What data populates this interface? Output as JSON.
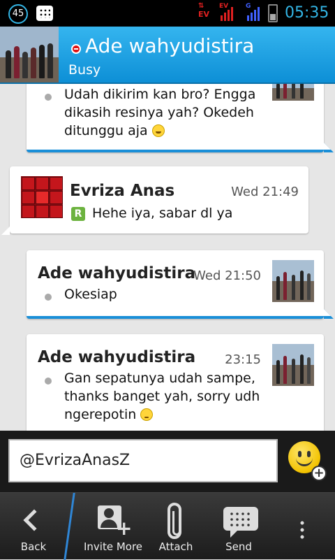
{
  "status_bar": {
    "notification_count": "45",
    "network_1": "EV",
    "network_2": "EV",
    "network_3": "G",
    "time": "05:35"
  },
  "header": {
    "contact_name": "Ade wahyudistira",
    "status": "Busy",
    "status_color": "#e01010",
    "accent": "#1a9ee0"
  },
  "messages": [
    {
      "sender": "",
      "time": "",
      "text_lines": [
        "Udah dikirim kan bro? Engga",
        "dikasih resinya yah? Okedeh",
        "ditunggu aja"
      ],
      "emoji": "grin-emoji",
      "outgoing": true
    },
    {
      "sender": "Evriza Anas",
      "time": "Wed 21:49",
      "text_lines": [
        "Hehe iya, sabar dl ya"
      ],
      "indicator": "R",
      "outgoing": false
    },
    {
      "sender": "Ade wahyudistira",
      "time": "Wed 21:50",
      "text_lines": [
        "Okesiap"
      ],
      "outgoing": true
    },
    {
      "sender": "Ade wahyudistira",
      "time": "23:15",
      "text_lines": [
        "Gan sepatunya udah sampe,",
        "thanks banget yah, sorry udh",
        "ngerepotin"
      ],
      "emoji": "worried-emoji",
      "outgoing": true
    }
  ],
  "composer": {
    "input_value": "@EvrizaAnasZ"
  },
  "action_bar": {
    "back": "Back",
    "invite": "Invite More",
    "attach": "Attach",
    "send": "Send"
  }
}
